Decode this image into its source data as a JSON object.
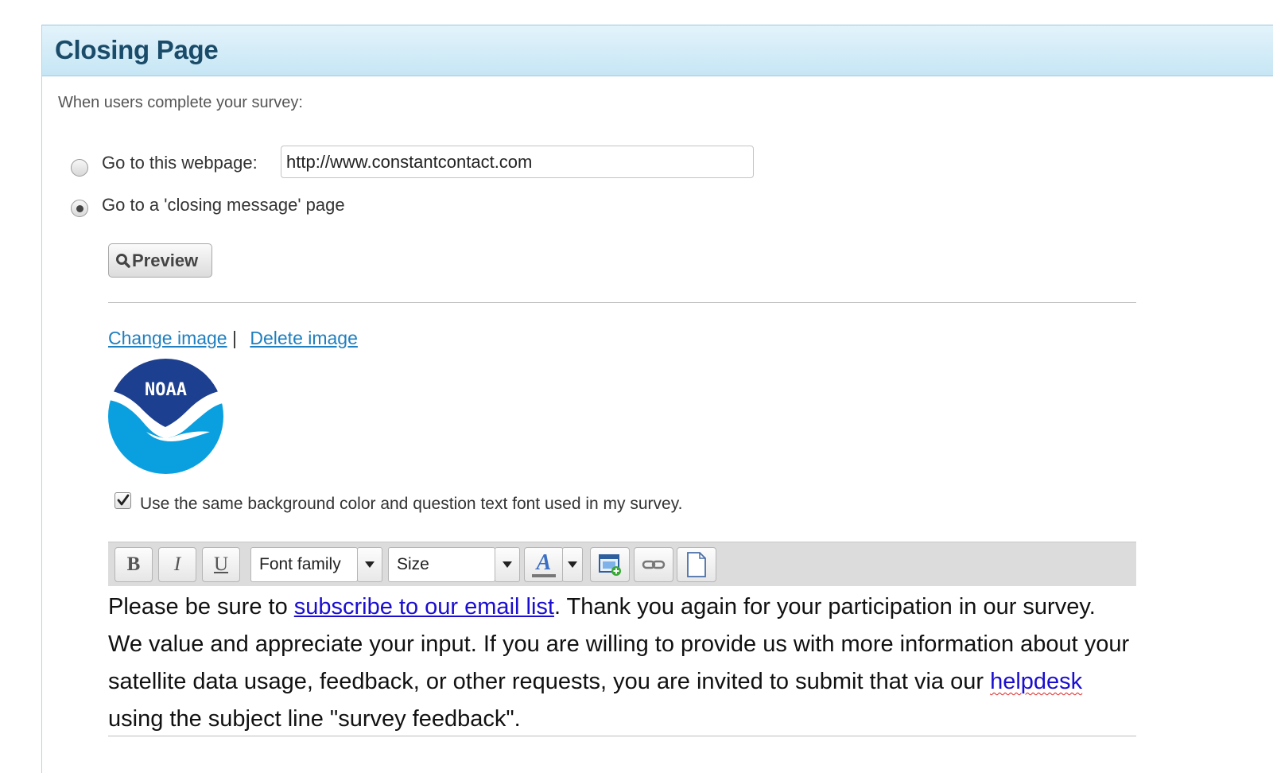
{
  "panel": {
    "title": "Closing Page",
    "intro": "When users complete your survey:"
  },
  "options": {
    "webpage_label": "Go to this webpage:",
    "webpage_url": "http://www.constantcontact.com",
    "closing_label": "Go to a 'closing message' page",
    "selected": "closing"
  },
  "preview_button": {
    "label": "Preview"
  },
  "image_links": {
    "change": "Change image",
    "separator": "|",
    "delete": "Delete image"
  },
  "logo": {
    "text": "NOAA",
    "colors": {
      "dark": "#1d3f8f",
      "light": "#0aa0e0"
    }
  },
  "same_style": {
    "checked": true,
    "label": "Use the same background color and question text font used in my survey."
  },
  "toolbar": {
    "bold": "B",
    "italic": "I",
    "underline": "U",
    "font_family": "Font family",
    "size": "Size",
    "text_color": "A",
    "icons": [
      "bold-icon",
      "italic-icon",
      "underline-icon",
      "text-color-icon",
      "insert-image-icon",
      "link-icon",
      "new-page-icon"
    ]
  },
  "message": {
    "p1": "Please be sure to ",
    "link1": "subscribe to our email list",
    "p2": ".  Thank you again for your participation in our survey. We value and appreciate your input.  If you are willing to provide us with more information about your satellite data usage, feedback, or other requests, you are invited to submit that via our ",
    "link2": "helpdesk",
    "p3": " using the subject line \"survey feedback\"."
  },
  "colors": {
    "header_bg": "#c6e6f5",
    "title": "#1a4c6a",
    "link": "#1f7fbf",
    "editor_link": "#1a0dcf"
  }
}
